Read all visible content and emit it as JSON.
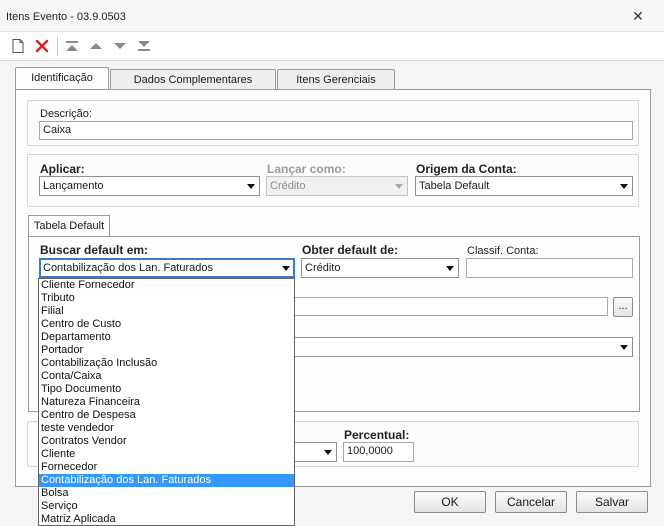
{
  "window": {
    "title": "Itens Evento - 03.9.0503",
    "close_glyph": "✕"
  },
  "toolbar": {
    "icons": [
      "new-document-icon",
      "delete-icon",
      "move-first-icon",
      "move-up-icon",
      "move-down-icon",
      "move-last-icon"
    ]
  },
  "tabs": [
    {
      "label": "Identificação",
      "active": true
    },
    {
      "label": "Dados Complementares",
      "active": false
    },
    {
      "label": "Itens Gerenciais",
      "active": false
    }
  ],
  "descricao": {
    "label": "Descrição:",
    "value": "Caixa"
  },
  "aplicar": {
    "label": "Aplicar:",
    "value": "Lançamento"
  },
  "lancar_como": {
    "label": "Lançar como:",
    "value": "Crédito",
    "disabled": true
  },
  "origem_conta": {
    "label": "Origem da Conta:",
    "value": "Tabela Default"
  },
  "subtab": {
    "label": "Tabela Default"
  },
  "buscar_default": {
    "label": "Buscar default em:",
    "value": "Contabilização dos Lan. Faturados",
    "options": [
      "Cliente Fornecedor",
      "Tributo",
      "Filial",
      "Centro de Custo",
      "Departamento",
      "Portador",
      "Contabilização Inclusão",
      "Conta/Caixa",
      "Tipo Documento",
      "Natureza Financeira",
      "Centro de Despesa",
      "teste vendedor",
      "Contratos Vendor",
      "Cliente",
      "Fornecedor",
      "Contabilização dos Lan. Faturados",
      "Bolsa",
      "Serviço",
      "Matriz Aplicada"
    ],
    "selected_index": 15
  },
  "obter_default": {
    "label": "Obter default de:",
    "value": "Crédito"
  },
  "classif_conta": {
    "label": "Classif. Conta:",
    "value": ""
  },
  "lookup_button": {
    "label": "..."
  },
  "percentual": {
    "label": "Percentual:",
    "value": "100,0000"
  },
  "buttons": {
    "ok": "OK",
    "cancel": "Cancelar",
    "save": "Salvar"
  },
  "colors": {
    "selection": "#3399ff",
    "focus_border": "#3b78d0",
    "delete_icon": "#e02020"
  }
}
